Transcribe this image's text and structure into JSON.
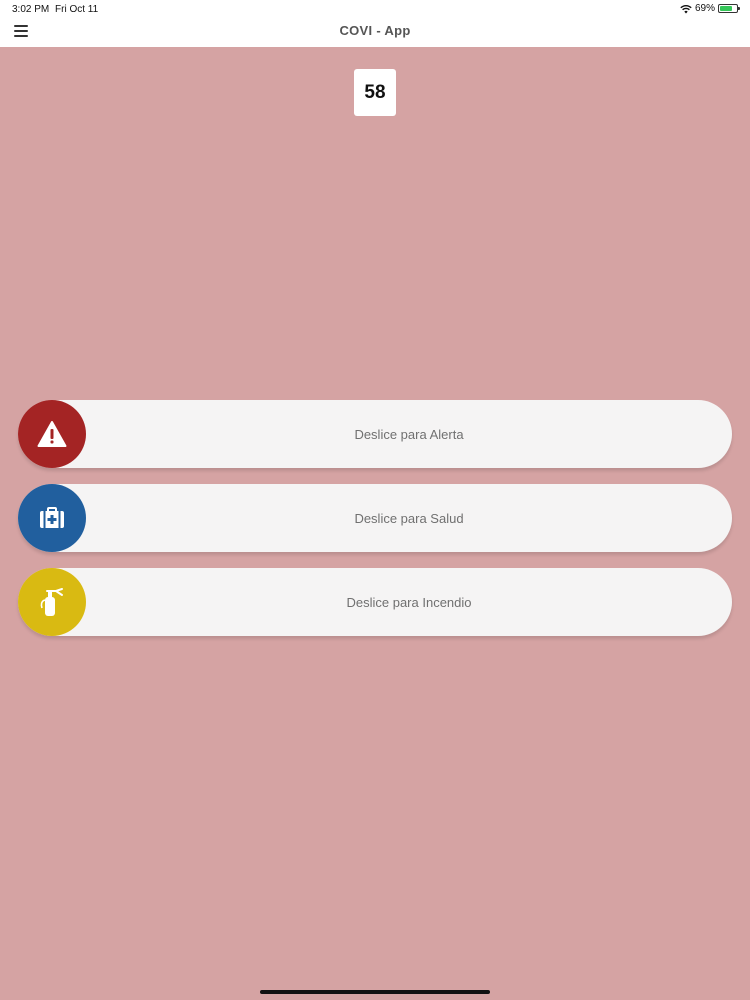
{
  "status": {
    "time": "3:02 PM",
    "date": "Fri Oct 11",
    "battery": "69%",
    "battery_level": 0.69,
    "icons": [
      "wifi-icon",
      "battery-icon"
    ]
  },
  "header": {
    "title": "COVI - App",
    "menu_icon": "menu-icon"
  },
  "counter": {
    "value": "58"
  },
  "sliders": [
    {
      "label": "Deslice para Alerta",
      "icon": "warning-triangle-icon",
      "color": "#a42424"
    },
    {
      "label": "Deslice para Salud",
      "icon": "first-aid-kit-icon",
      "color": "#215f9e"
    },
    {
      "label": "Deslice para Incendio",
      "icon": "fire-extinguisher-icon",
      "color": "#d9ba12"
    }
  ],
  "colors": {
    "background": "#d5a3a3",
    "header_background": "#ffffff",
    "slider_track": "#f5f4f4"
  }
}
